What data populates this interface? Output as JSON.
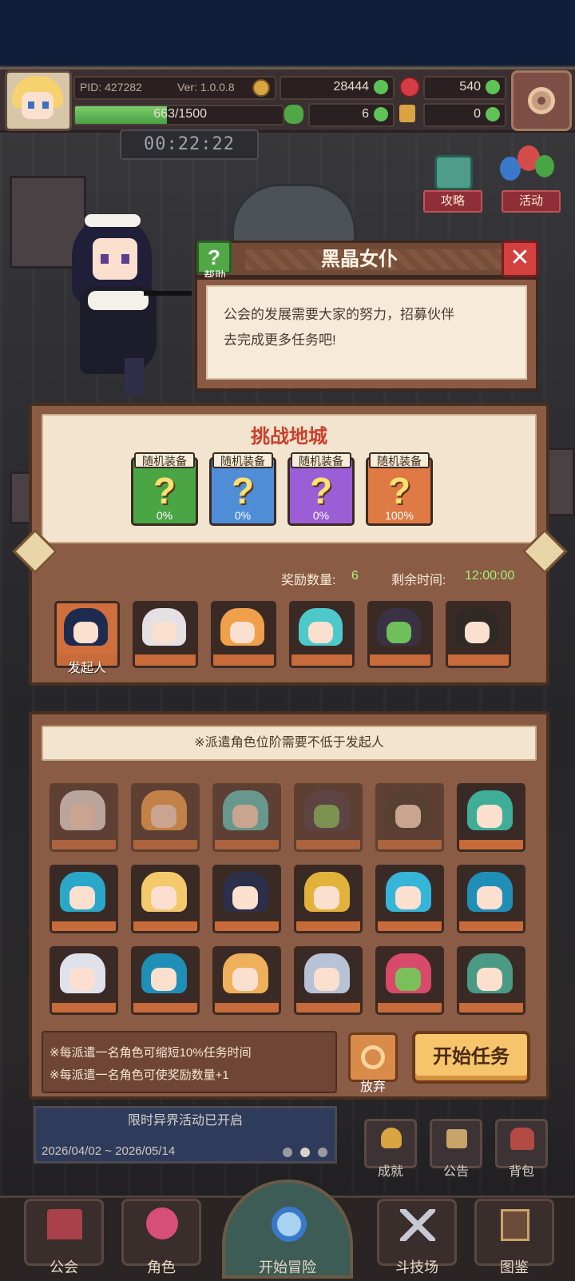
{
  "status": {
    "pid": "PID: 427282",
    "version": "Ver: 1.0.0.8",
    "gold": "28444",
    "gems": "540",
    "xp_text": "663/1500",
    "xp_progress": 0.442,
    "clover": "6",
    "item": "0",
    "timer": "00:22:22"
  },
  "side_buttons": {
    "guide": "攻略",
    "events": "活动"
  },
  "dialog": {
    "title": "黑晶女仆",
    "help_label": "帮助",
    "close": "✕",
    "text_line1": "公会的发展需要大家的努力，招募伙伴",
    "text_line2": "去完成更多任务吧!"
  },
  "dungeon": {
    "title": "挑战地城",
    "rewards": [
      {
        "label": "随机装备",
        "pct": "0%",
        "color": "#4aa545"
      },
      {
        "label": "随机装备",
        "pct": "0%",
        "color": "#4f8ed6"
      },
      {
        "label": "随机装备",
        "pct": "0%",
        "color": "#9a5ed6"
      },
      {
        "label": "随机装备",
        "pct": "100%",
        "color": "#e07a45"
      }
    ],
    "reward_count_label": "奖励数量:",
    "reward_count": "6",
    "time_left_label": "剩余时间:",
    "time_left": "12:00:00",
    "initiator_label": "发起人"
  },
  "dispatch": {
    "notice": "※派遣角色位阶需要不低于发起人",
    "tip1": "※每派遣一名角色可缩短10%任务时间",
    "tip2": "※每派遣一名角色可使奖励数量+1",
    "abandon_label": "放弃",
    "start_label": "开始任务"
  },
  "background": {
    "event_title": "限时异界活动已开启",
    "event_dates": "2026/04/02 ~ 2026/05/14",
    "achievements": "成就",
    "announcements": "公告",
    "bag": "背包"
  },
  "nav": {
    "guild": "公会",
    "characters": "角色",
    "adventure": "开始冒险",
    "arena": "斗技场",
    "gallery": "图鉴"
  }
}
